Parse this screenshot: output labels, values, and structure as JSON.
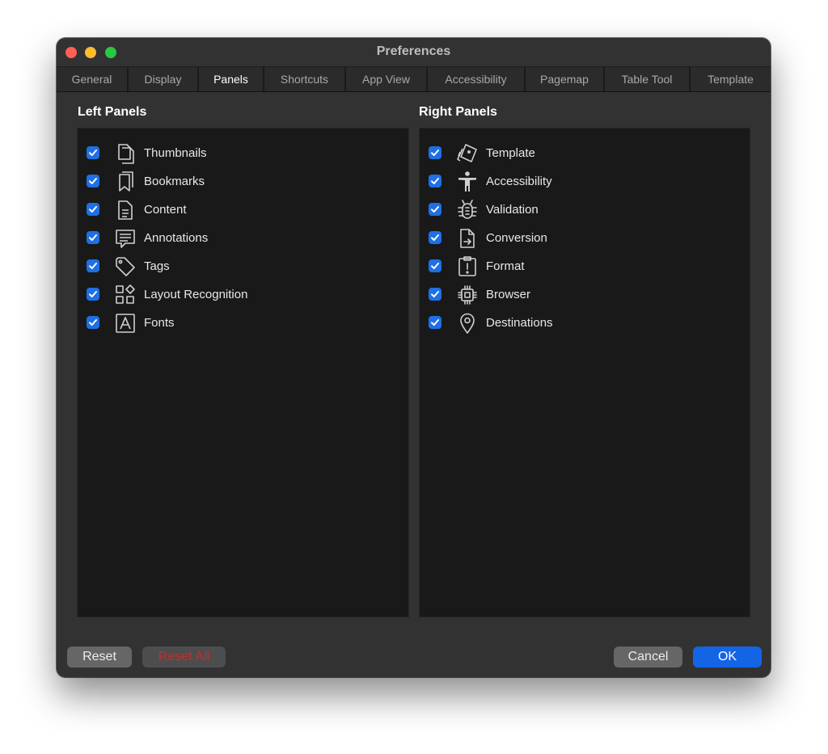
{
  "window": {
    "title": "Preferences"
  },
  "tabs": [
    {
      "label": "General",
      "active": false
    },
    {
      "label": "Display",
      "active": false
    },
    {
      "label": "Panels",
      "active": true
    },
    {
      "label": "Shortcuts",
      "active": false
    },
    {
      "label": "App View",
      "active": false
    },
    {
      "label": "Accessibility",
      "active": false
    },
    {
      "label": "Pagemap",
      "active": false
    },
    {
      "label": "Table Tool",
      "active": false
    },
    {
      "label": "Template",
      "active": false
    }
  ],
  "left_panels": {
    "title": "Left Panels",
    "items": [
      {
        "label": "Thumbnails",
        "icon": "thumbnails-icon",
        "checked": true
      },
      {
        "label": "Bookmarks",
        "icon": "bookmark-icon",
        "checked": true
      },
      {
        "label": "Content",
        "icon": "document-icon",
        "checked": true
      },
      {
        "label": "Annotations",
        "icon": "annotation-icon",
        "checked": true
      },
      {
        "label": "Tags",
        "icon": "tag-icon",
        "checked": true
      },
      {
        "label": "Layout Recognition",
        "icon": "layout-icon",
        "checked": true
      },
      {
        "label": "Fonts",
        "icon": "font-icon",
        "checked": true
      }
    ]
  },
  "right_panels": {
    "title": "Right Panels",
    "items": [
      {
        "label": "Template",
        "icon": "template-icon",
        "checked": true
      },
      {
        "label": "Accessibility",
        "icon": "accessibility-icon",
        "checked": true
      },
      {
        "label": "Validation",
        "icon": "bug-icon",
        "checked": true
      },
      {
        "label": "Conversion",
        "icon": "conversion-icon",
        "checked": true
      },
      {
        "label": "Format",
        "icon": "format-icon",
        "checked": true
      },
      {
        "label": "Browser",
        "icon": "chip-icon",
        "checked": true
      },
      {
        "label": "Destinations",
        "icon": "location-pin-icon",
        "checked": true
      }
    ]
  },
  "buttons": {
    "reset": "Reset",
    "reset_all": "Reset All",
    "cancel": "Cancel",
    "ok": "OK"
  },
  "colors": {
    "accent": "#1f6fe5",
    "primary_button": "#1464e6",
    "reset_all_text": "#c0302f"
  }
}
